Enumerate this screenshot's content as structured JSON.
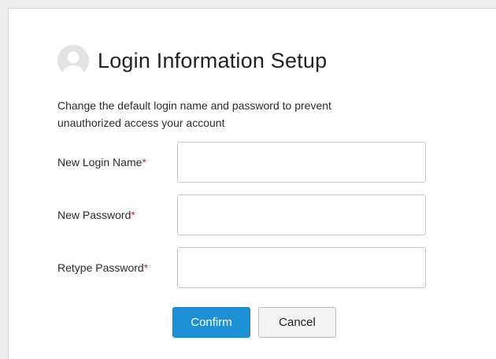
{
  "header": {
    "title": "Login Information Setup",
    "avatar_icon": "user-avatar-icon"
  },
  "description": "Change the default login name and password to prevent unauthorized access your account",
  "form": {
    "fields": [
      {
        "label": "New Login Name",
        "required_mark": "*",
        "value": ""
      },
      {
        "label": "New Password",
        "required_mark": "*",
        "value": ""
      },
      {
        "label": "Retype Password",
        "required_mark": "*",
        "value": ""
      }
    ],
    "confirm_label": "Confirm",
    "cancel_label": "Cancel"
  },
  "colors": {
    "accent": "#1e91d6",
    "required": "#d12b2b"
  }
}
